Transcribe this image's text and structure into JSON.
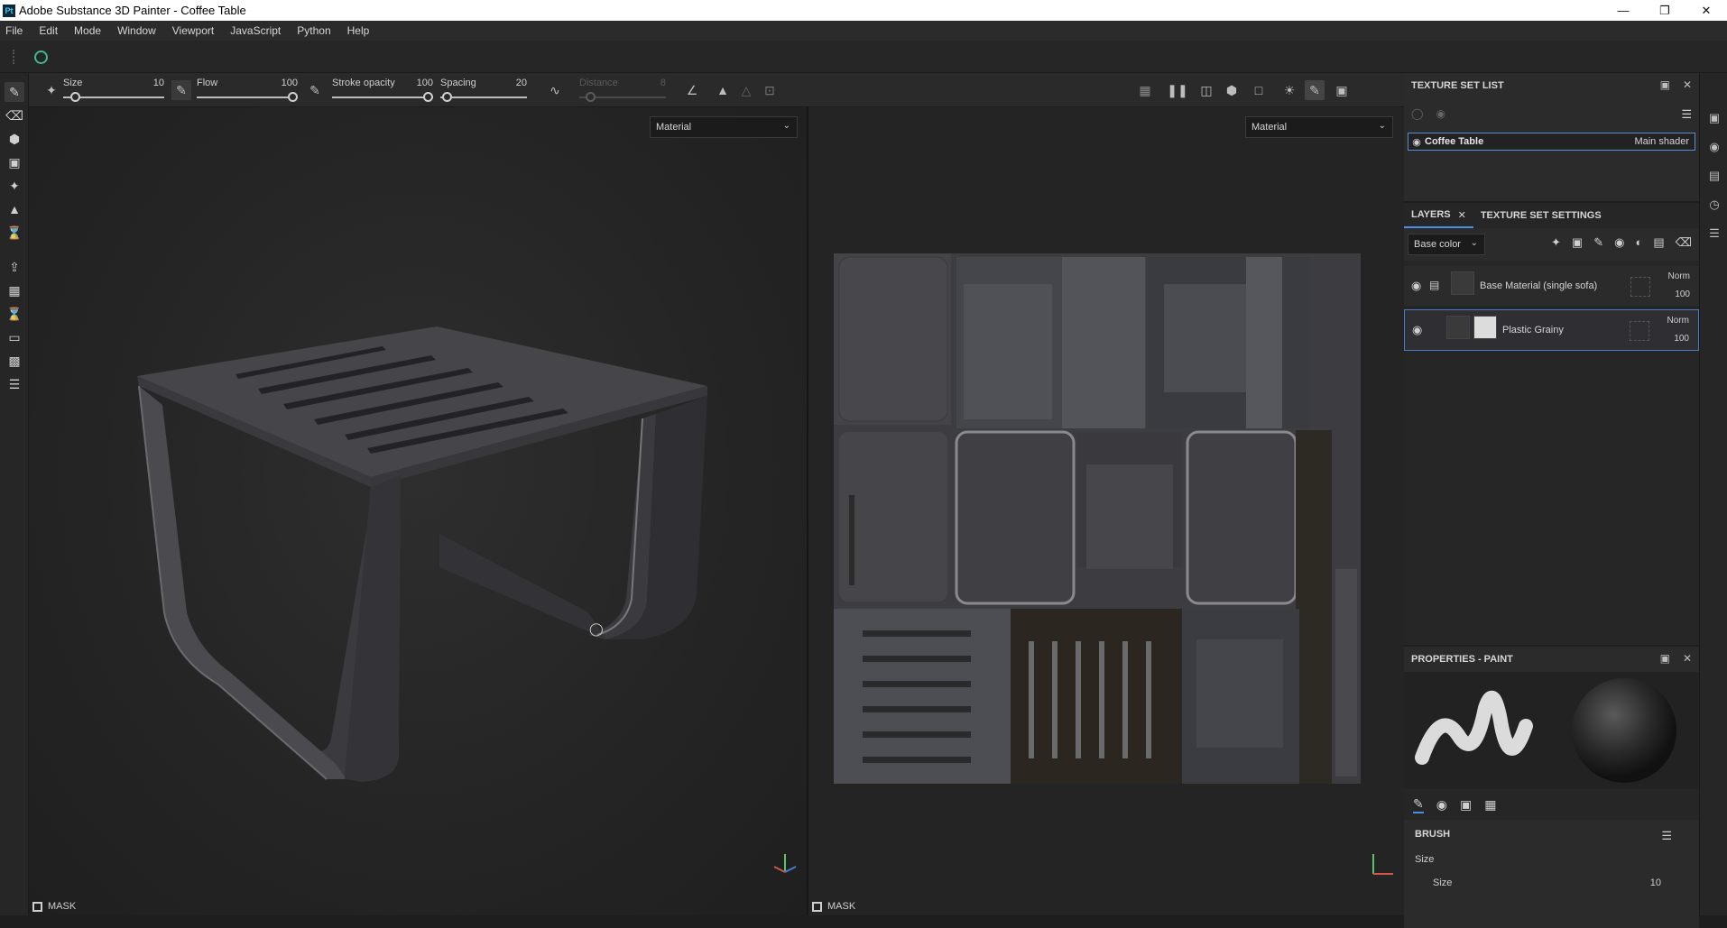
{
  "window": {
    "title": "Adobe Substance 3D Painter - Coffee Table",
    "app_badge": "Pt"
  },
  "menu": [
    "File",
    "Edit",
    "Mode",
    "Window",
    "Viewport",
    "JavaScript",
    "Python",
    "Help"
  ],
  "toolbar": {
    "size": {
      "label": "Size",
      "value": "10",
      "fraction": 0.08
    },
    "flow": {
      "label": "Flow",
      "value": "100",
      "fraction": 1.0
    },
    "stroke_opacity": {
      "label": "Stroke opacity",
      "value": "100",
      "fraction": 1.0
    },
    "spacing": {
      "label": "Spacing",
      "value": "20",
      "fraction": 0.02
    },
    "distance": {
      "label": "Distance",
      "value": "8",
      "fraction": 0.08,
      "disabled": true
    }
  },
  "viewport3d": {
    "mode_select": "Material",
    "mask_label": "MASK"
  },
  "viewport2d": {
    "mode_select": "Material",
    "mask_label": "MASK"
  },
  "texture_set_list": {
    "title": "TEXTURE SET LIST",
    "items": [
      {
        "name": "Coffee Table",
        "shader": "Main shader"
      }
    ]
  },
  "layers": {
    "tabs": [
      "LAYERS",
      "TEXTURE SET SETTINGS"
    ],
    "channel": "Base color",
    "items": [
      {
        "name": "Base Material (single sofa)",
        "blend": "Norm",
        "opacity": "100"
      },
      {
        "name": "Plastic Grainy",
        "blend": "Norm",
        "opacity": "100"
      }
    ]
  },
  "properties": {
    "title": "PROPERTIES - PAINT",
    "brush_heading": "BRUSH",
    "size_group": "Size",
    "size_label": "Size",
    "size_value": "10"
  },
  "colors": {
    "accent": "#4a90e2",
    "selection": "#4a7ac8",
    "spinner": "#3fb88a"
  }
}
